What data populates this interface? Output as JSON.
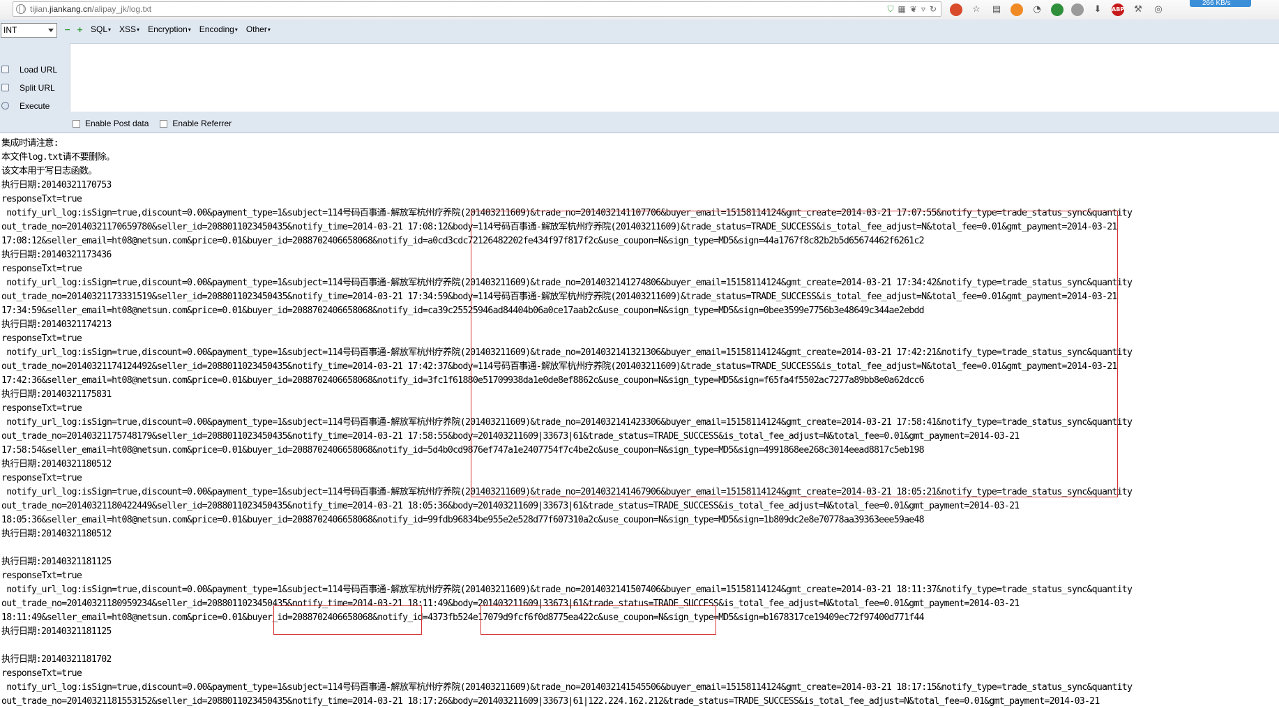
{
  "browser": {
    "url_prefix": "tijian.",
    "url_domain": "jiankang.cn",
    "url_path": "/alipay_jk/log.txt",
    "download_speed": "266 KB/s"
  },
  "hackbar": {
    "select_value": "INT",
    "menus": [
      "SQL",
      "XSS",
      "Encryption",
      "Encoding",
      "Other"
    ],
    "load_url": "Load URL",
    "split_url": "Split URL",
    "execute": "Execute",
    "enable_post": "Enable Post data",
    "enable_referrer": "Enable Referrer"
  },
  "log": {
    "lines": [
      "集成时请注意:",
      "本文件log.txt请不要删除。",
      "该文本用于写日志函数。",
      "执行日期:20140321170753",
      "responseTxt=true",
      " notify_url_log:isSign=true,discount=0.00&payment_type=1&subject=114号码百事通-解放军杭州疗养院(201403211609)&trade_no=2014032141107706&buyer_email=15158114124&gmt_create=2014-03-21 17:07:55&notify_type=trade_status_sync&quantity",
      "out_trade_no=20140321170659780&seller_id=2088011023450435&notify_time=2014-03-21 17:08:12&body=114号码百事通-解放军杭州疗养院(201403211609)&trade_status=TRADE_SUCCESS&is_total_fee_adjust=N&total_fee=0.01&gmt_payment=2014-03-21",
      "17:08:12&seller_email=ht08@netsun.com&price=0.01&buyer_id=2088702406658068&notify_id=a0cd3cdc72126482202fe434f97f817f2c&use_coupon=N&sign_type=MD5&sign=44a1767f8c82b2b5d65674462f6261c2",
      "执行日期:20140321173436",
      "responseTxt=true",
      " notify_url_log:isSign=true,discount=0.00&payment_type=1&subject=114号码百事通-解放军杭州疗养院(201403211609)&trade_no=2014032141274806&buyer_email=15158114124&gmt_create=2014-03-21 17:34:42&notify_type=trade_status_sync&quantity",
      "out_trade_no=20140321173331519&seller_id=2088011023450435&notify_time=2014-03-21 17:34:59&body=114号码百事通-解放军杭州疗养院(201403211609)&trade_status=TRADE_SUCCESS&is_total_fee_adjust=N&total_fee=0.01&gmt_payment=2014-03-21",
      "17:34:59&seller_email=ht08@netsun.com&price=0.01&buyer_id=2088702406658068&notify_id=ca39c25525946ad84404b06a0ce17aab2c&use_coupon=N&sign_type=MD5&sign=0bee3599e7756b3e48649c344ae2ebdd",
      "执行日期:20140321174213",
      "responseTxt=true",
      " notify_url_log:isSign=true,discount=0.00&payment_type=1&subject=114号码百事通-解放军杭州疗养院(201403211609)&trade_no=2014032141321306&buyer_email=15158114124&gmt_create=2014-03-21 17:42:21&notify_type=trade_status_sync&quantity",
      "out_trade_no=20140321174124492&seller_id=2088011023450435&notify_time=2014-03-21 17:42:37&body=114号码百事通-解放军杭州疗养院(201403211609)&trade_status=TRADE_SUCCESS&is_total_fee_adjust=N&total_fee=0.01&gmt_payment=2014-03-21",
      "17:42:36&seller_email=ht08@netsun.com&price=0.01&buyer_id=2088702406658068&notify_id=3fc1f61880e51709938da1e0de8ef8862c&use_coupon=N&sign_type=MD5&sign=f65fa4f5502ac7277a89bb8e0a62dcc6",
      "执行日期:20140321175831",
      "responseTxt=true",
      " notify_url_log:isSign=true,discount=0.00&payment_type=1&subject=114号码百事通-解放军杭州疗养院(201403211609)&trade_no=2014032141423306&buyer_email=15158114124&gmt_create=2014-03-21 17:58:41&notify_type=trade_status_sync&quantity",
      "out_trade_no=20140321175748179&seller_id=2088011023450435&notify_time=2014-03-21 17:58:55&body=201403211609|33673|61&trade_status=TRADE_SUCCESS&is_total_fee_adjust=N&total_fee=0.01&gmt_payment=2014-03-21",
      "17:58:54&seller_email=ht08@netsun.com&price=0.01&buyer_id=2088702406658068&notify_id=5d4b0cd9876ef747a1e2407754f7c4be2c&use_coupon=N&sign_type=MD5&sign=4991868ee268c3014eead8817c5eb198",
      "执行日期:20140321180512",
      "responseTxt=true",
      " notify_url_log:isSign=true,discount=0.00&payment_type=1&subject=114号码百事通-解放军杭州疗养院(201403211609)&trade_no=2014032141467906&buyer_email=15158114124&gmt_create=2014-03-21 18:05:21&notify_type=trade_status_sync&quantity",
      "out_trade_no=20140321180422449&seller_id=2088011023450435&notify_time=2014-03-21 18:05:36&body=201403211609|33673|61&trade_status=TRADE_SUCCESS&is_total_fee_adjust=N&total_fee=0.01&gmt_payment=2014-03-21",
      "18:05:36&seller_email=ht08@netsun.com&price=0.01&buyer_id=2088702406658068&notify_id=99fdb96834be955e2e528d77f607310a2c&use_coupon=N&sign_type=MD5&sign=1b809dc2e8e70778aa39363eee59ae48",
      "执行日期:20140321180512",
      "",
      "执行日期:20140321181125",
      "responseTxt=true",
      " notify_url_log:isSign=true,discount=0.00&payment_type=1&subject=114号码百事通-解放军杭州疗养院(201403211609)&trade_no=2014032141507406&buyer_email=15158114124&gmt_create=2014-03-21 18:11:37&notify_type=trade_status_sync&quantity",
      "out_trade_no=20140321180959234&seller_id=2088011023450435&notify_time=2014-03-21 18:11:49&body=201403211609|33673|61&trade_status=TRADE_SUCCESS&is_total_fee_adjust=N&total_fee=0.01&gmt_payment=2014-03-21",
      "18:11:49&seller_email=ht08@netsun.com&price=0.01&buyer_id=2088702406658068&notify_id=4373fb524e17079d9fcf6f0d8775ea422c&use_coupon=N&sign_type=MD5&sign=b1678317ce19409ec72f97400d771f44",
      "执行日期:20140321181125",
      "",
      "执行日期:20140321181702",
      "responseTxt=true",
      " notify_url_log:isSign=true,discount=0.00&payment_type=1&subject=114号码百事通-解放军杭州疗养院(201403211609)&trade_no=2014032141545506&buyer_email=15158114124&gmt_create=2014-03-21 18:17:15&notify_type=trade_status_sync&quantity",
      "out_trade_no=20140321181553152&seller_id=2088011023450435&notify_time=2014-03-21 18:17:26&body=201403211609|33673|61|122.224.162.212&trade_status=TRADE_SUCCESS&is_total_fee_adjust=N&total_fee=0.01&gmt_payment=2014-03-21"
    ]
  },
  "colors": {
    "highlight_box": "#d43232",
    "hackbar_bg": "#dfe7f1"
  }
}
